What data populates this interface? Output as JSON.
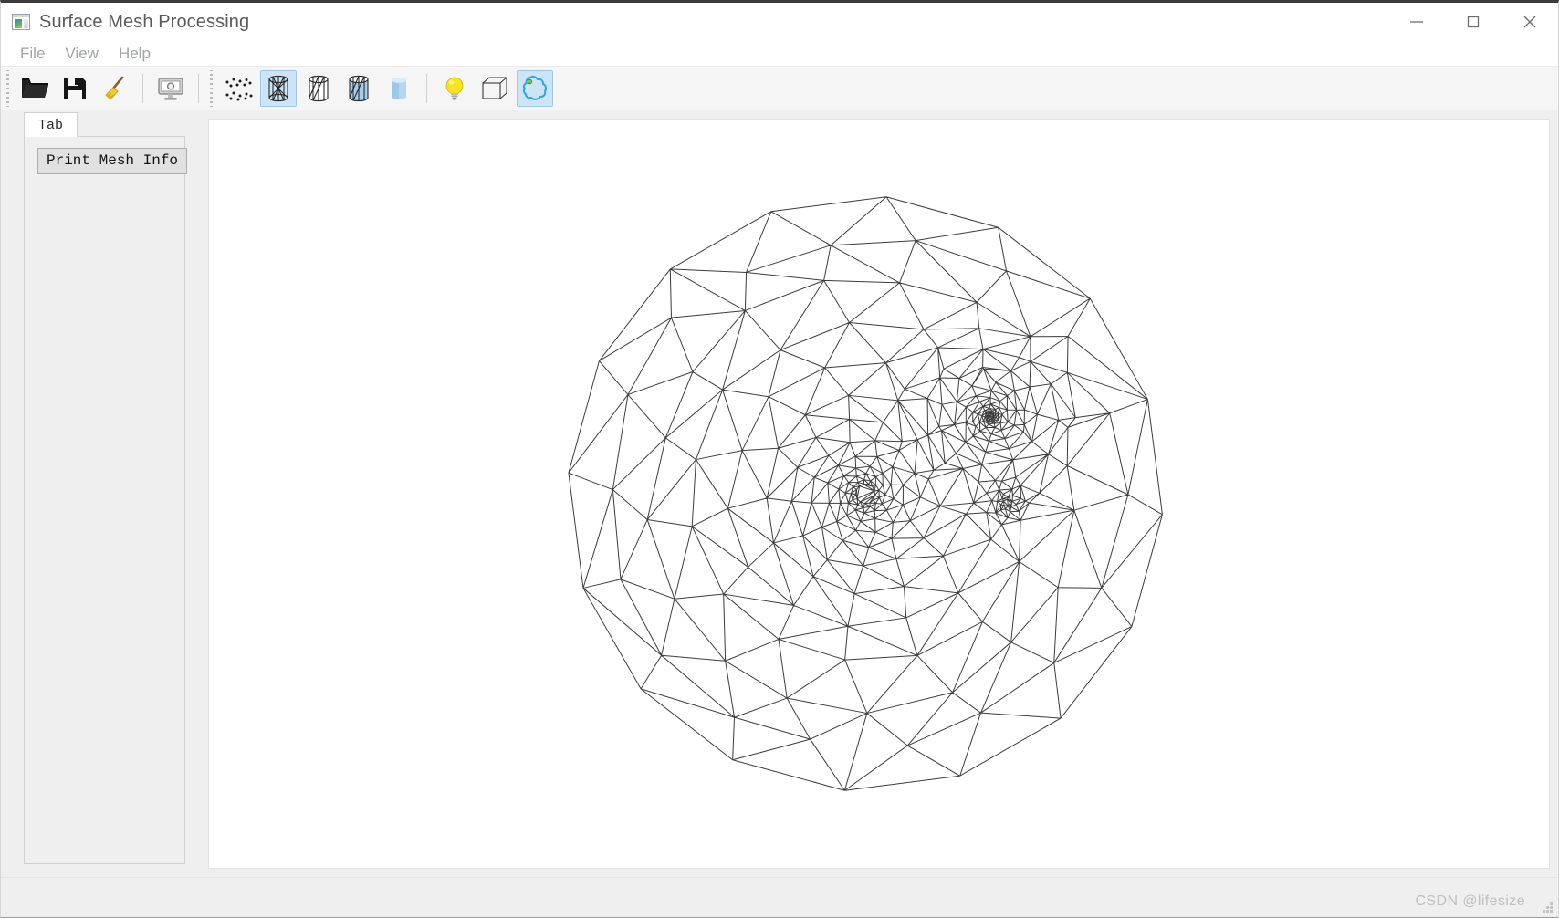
{
  "window": {
    "title": "Surface Mesh Processing",
    "icon": "app-window-icon",
    "controls": {
      "minimize": "—",
      "maximize": "□",
      "close": "✕"
    }
  },
  "menubar": {
    "items": [
      {
        "label": "File",
        "name": "menu-file"
      },
      {
        "label": "View",
        "name": "menu-view"
      },
      {
        "label": "Help",
        "name": "menu-help"
      }
    ]
  },
  "toolbar": {
    "groups": [
      {
        "name": "file-group",
        "buttons": [
          {
            "icon": "open-folder-icon",
            "tooltip": "Open",
            "active": false
          },
          {
            "icon": "save-floppy-icon",
            "tooltip": "Save",
            "active": false
          },
          {
            "icon": "clear-broom-icon",
            "tooltip": "Clear",
            "active": false
          }
        ]
      },
      {
        "name": "capture-group",
        "buttons": [
          {
            "icon": "screenshot-monitor-icon",
            "tooltip": "Snapshot",
            "active": false
          }
        ]
      },
      {
        "name": "render-mode-group",
        "buttons": [
          {
            "icon": "points-cloud-icon",
            "tooltip": "Points",
            "active": false
          },
          {
            "icon": "wireframe-solid-icon",
            "tooltip": "Wireframe",
            "active": true
          },
          {
            "icon": "hidden-line-icon",
            "tooltip": "Hidden Line",
            "active": false
          },
          {
            "icon": "solid-wireframe-icon",
            "tooltip": "Solid Wireframe",
            "active": false
          },
          {
            "icon": "solid-flat-icon",
            "tooltip": "Flat Shading",
            "active": false
          }
        ]
      },
      {
        "name": "display-group",
        "buttons": [
          {
            "icon": "lightbulb-icon",
            "tooltip": "Lighting",
            "active": false
          },
          {
            "icon": "bounding-box-icon",
            "tooltip": "Bounding Box",
            "active": false
          },
          {
            "icon": "boundary-contour-icon",
            "tooltip": "Boundary",
            "active": true
          }
        ]
      }
    ]
  },
  "sidebar": {
    "tabs": [
      {
        "label": "Tab",
        "name": "tab-main",
        "selected": true
      }
    ],
    "buttons": [
      {
        "label": "Print Mesh Info",
        "name": "print-mesh-info-button"
      }
    ]
  },
  "viewport": {
    "name": "mesh-viewport",
    "background": "#ffffff",
    "edge_color": "#3c3c3c",
    "edge_width": 1,
    "content": "adaptively-refined triangular surface mesh of a circular disk, refinement concentrated upper-right of center"
  },
  "statusbar": {
    "message": "",
    "watermark": "CSDN @lifesize"
  },
  "colors": {
    "accent": "#cde4f7",
    "accent_border": "#9fc6e8",
    "window_bg": "#efefef",
    "titlebar_bg": "#ffffff",
    "toolbar_bg": "#f5f5f5",
    "menu_text": "#a0a3a8",
    "title_text": "#5b5b5b"
  }
}
